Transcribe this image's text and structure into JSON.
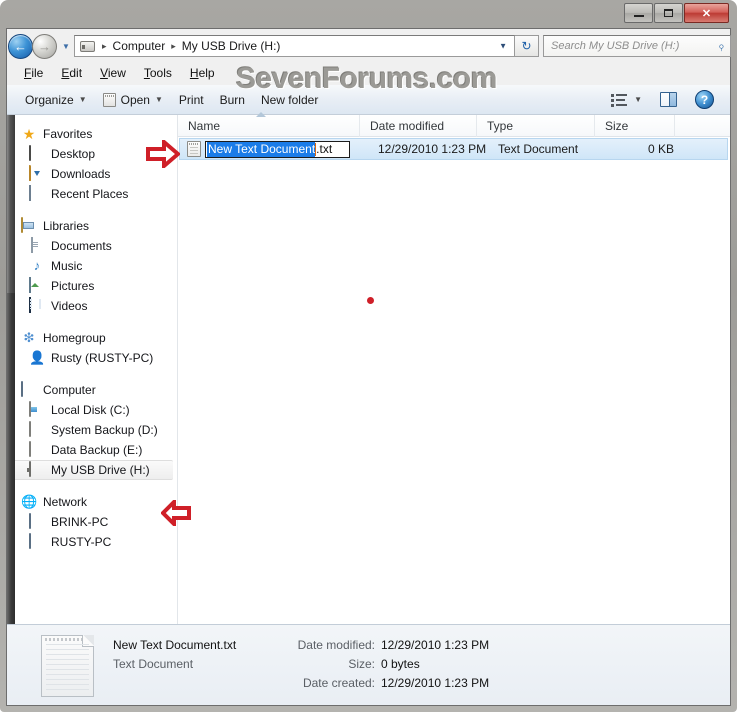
{
  "window": {
    "buttons": {
      "minimize": "–",
      "maximize": "❐",
      "close": "✕"
    }
  },
  "address_bar": {
    "back_glyph": "←",
    "forward_glyph": "→",
    "history_caret": "▼",
    "crumbs": [
      "Computer",
      "My USB Drive (H:)"
    ],
    "separator": "▸",
    "dropdown_caret": "▼",
    "refresh_glyph": "↻",
    "drive_icon": "usb-drive-icon"
  },
  "search": {
    "placeholder": "Search My USB Drive (H:)",
    "icon": "search-icon",
    "icon_glyph": "⌕"
  },
  "menu": {
    "items": [
      {
        "accel": "F",
        "rest": "ile"
      },
      {
        "accel": "E",
        "rest": "dit"
      },
      {
        "accel": "V",
        "rest": "iew"
      },
      {
        "accel": "T",
        "rest": "ools"
      },
      {
        "accel": "H",
        "rest": "elp"
      }
    ]
  },
  "watermark": {
    "text": "SevenForums.com"
  },
  "command_bar": {
    "organize": "Organize",
    "open": "Open",
    "print": "Print",
    "burn": "Burn",
    "new_folder": "New folder",
    "caret": "▼",
    "help_glyph": "?",
    "icons": [
      "notepad-icon",
      "change-view-icon",
      "preview-pane-icon",
      "help-icon"
    ]
  },
  "nav_pane": {
    "groups": [
      {
        "root": {
          "label": "Favorites",
          "icon": "star-icon"
        },
        "children": [
          {
            "label": "Desktop",
            "icon": "desktop-icon"
          },
          {
            "label": "Downloads",
            "icon": "downloads-icon"
          },
          {
            "label": "Recent Places",
            "icon": "recent-places-icon"
          }
        ]
      },
      {
        "root": {
          "label": "Libraries",
          "icon": "libraries-icon"
        },
        "children": [
          {
            "label": "Documents",
            "icon": "documents-icon"
          },
          {
            "label": "Music",
            "icon": "music-icon"
          },
          {
            "label": "Pictures",
            "icon": "pictures-icon"
          },
          {
            "label": "Videos",
            "icon": "videos-icon"
          }
        ]
      },
      {
        "root": {
          "label": "Homegroup",
          "icon": "homegroup-icon"
        },
        "children": [
          {
            "label": "Rusty (RUSTY-PC)",
            "icon": "user-icon"
          }
        ]
      },
      {
        "root": {
          "label": "Computer",
          "icon": "computer-icon"
        },
        "children": [
          {
            "label": "Local Disk (C:)",
            "icon": "system-drive-icon",
            "selected": false
          },
          {
            "label": "System Backup (D:)",
            "icon": "hard-drive-icon",
            "selected": false
          },
          {
            "label": "Data Backup (E:)",
            "icon": "hard-drive-icon",
            "selected": false
          },
          {
            "label": "My USB Drive (H:)",
            "icon": "usb-drive-icon",
            "selected": true
          }
        ]
      },
      {
        "root": {
          "label": "Network",
          "icon": "network-icon"
        },
        "children": [
          {
            "label": "BRINK-PC",
            "icon": "computer-icon"
          },
          {
            "label": "RUSTY-PC",
            "icon": "computer-icon"
          }
        ]
      }
    ]
  },
  "file_list": {
    "columns": [
      {
        "label": "Name",
        "sorted": "asc"
      },
      {
        "label": "Date modified"
      },
      {
        "label": "Type"
      },
      {
        "label": "Size"
      }
    ],
    "rows": [
      {
        "icon": "text-file-icon",
        "name_selected": "New Text Document",
        "name_extension": ".txt",
        "date_modified": "12/29/2010 1:23 PM",
        "type": "Text Document",
        "size": "0 KB",
        "renaming": true
      }
    ]
  },
  "markers": {
    "arrow_right": "red-right-arrow",
    "arrow_left": "red-left-arrow",
    "dot": "red-dot"
  },
  "details_pane": {
    "icon": "text-document-large-icon",
    "file_name": "New Text Document.txt",
    "file_type": "Text Document",
    "fields": [
      {
        "label": "Date modified:",
        "value": "12/29/2010 1:23 PM"
      },
      {
        "label": "Size:",
        "value": "0 bytes"
      },
      {
        "label": "Date created:",
        "value": "12/29/2010 1:23 PM"
      }
    ]
  },
  "colors": {
    "selection_blue": "#1b7ce8",
    "row_highlight": "#cfe6f8",
    "marker_red": "#cf1f28",
    "watermark_gray": "#9b9a96"
  }
}
